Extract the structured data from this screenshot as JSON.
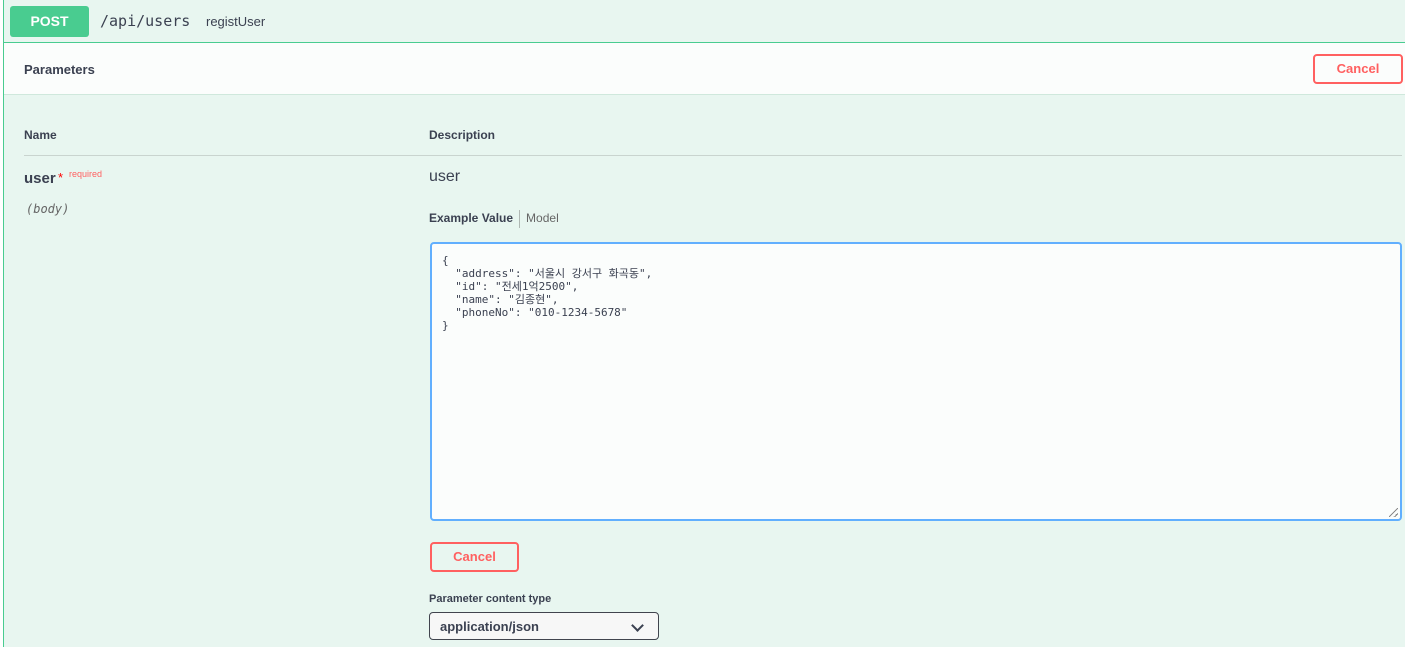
{
  "operation": {
    "method": "POST",
    "path": "/api/users",
    "operation_id": "registUser"
  },
  "parameters_section": {
    "title": "Parameters",
    "cancel_label": "Cancel",
    "columns": {
      "name": "Name",
      "description": "Description"
    }
  },
  "parameter": {
    "name": "user",
    "required_star": "*",
    "required_label": "required",
    "location": "(body)",
    "description": "user",
    "tabs": {
      "example_value": "Example Value",
      "model": "Model"
    },
    "body_value": "{\n  \"address\": \"서울시 강서구 화곡동\",\n  \"id\": \"전세1억2500\",\n  \"name\": \"김종현\",\n  \"phoneNo\": \"010-1234-5678\"\n}",
    "cancel_label": "Cancel",
    "content_type_label": "Parameter content type",
    "content_type_value": "application/json"
  },
  "colors": {
    "post_green": "#49cc90",
    "cancel_red": "#ff6060",
    "editor_focus_blue": "#61affe"
  }
}
